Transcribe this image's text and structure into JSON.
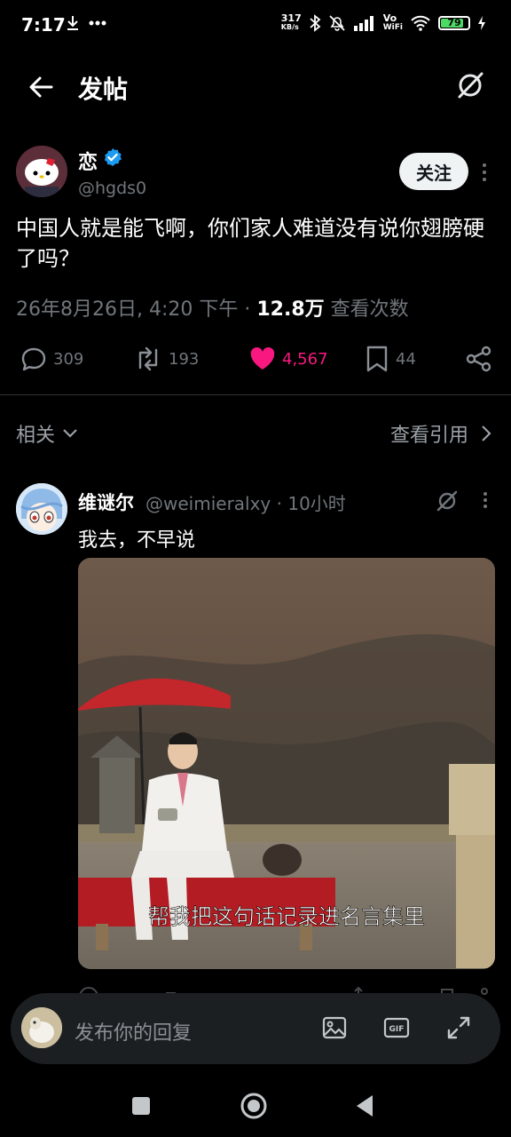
{
  "status_bar": {
    "time": "7:17",
    "net_speed": "317",
    "net_unit": "KB/s",
    "volte": "Vo",
    "wifi_label": "WiFi",
    "battery": "79",
    "battery_level": 0.79
  },
  "header": {
    "title": "发帖",
    "back_icon": "arrow-left-icon",
    "right_icon": "grok-icon"
  },
  "post": {
    "author_name": "恋",
    "handle": "@hgds0",
    "follow_label": "关注",
    "text": "中国人就是能飞啊，你们家人难道没有说你翅膀硬了吗？",
    "timestamp": "26年8月26日, 4:20 下午",
    "separator": "·",
    "views": "12.8万",
    "views_label": "查看次数",
    "actions": {
      "replies": "309",
      "reposts": "193",
      "likes": "4,567",
      "bookmarks": "44"
    }
  },
  "related": {
    "label": "相关",
    "view_quotes": "查看引用"
  },
  "reply": {
    "name": "维谜尔",
    "handle": "@weimieralxy",
    "dot": "·",
    "time": "10小时",
    "text": "我去，不早说",
    "media_subtitle": "帮我把这句话记录进名言集里"
  },
  "composer": {
    "placeholder": "发布你的回复",
    "gif_label": "GIF"
  },
  "colors": {
    "background": "#000000",
    "like": "#f91880",
    "verified": "#1d9bf0",
    "muted": "#71767b"
  }
}
